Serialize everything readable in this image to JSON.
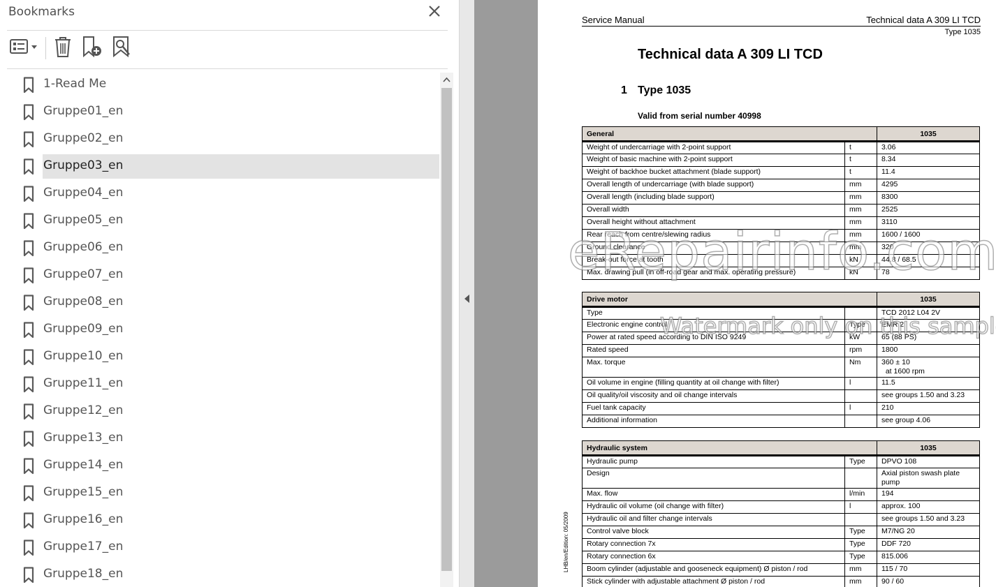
{
  "panel": {
    "title": "Bookmarks",
    "bookmarks": [
      {
        "label": "1-Read Me"
      },
      {
        "label": "Gruppe01_en"
      },
      {
        "label": "Gruppe02_en"
      },
      {
        "label": "Gruppe03_en",
        "selected": true
      },
      {
        "label": "Gruppe04_en"
      },
      {
        "label": "Gruppe05_en"
      },
      {
        "label": "Gruppe06_en"
      },
      {
        "label": "Gruppe07_en"
      },
      {
        "label": "Gruppe08_en"
      },
      {
        "label": "Gruppe09_en"
      },
      {
        "label": "Gruppe10_en"
      },
      {
        "label": "Gruppe11_en"
      },
      {
        "label": "Gruppe12_en"
      },
      {
        "label": "Gruppe13_en"
      },
      {
        "label": "Gruppe14_en"
      },
      {
        "label": "Gruppe15_en"
      },
      {
        "label": "Gruppe16_en"
      },
      {
        "label": "Gruppe17_en"
      },
      {
        "label": "Gruppe18_en"
      }
    ],
    "toolbar_icons": [
      "options-list-icon",
      "delete-bookmark-icon",
      "new-bookmark-icon",
      "find-bookmark-icon"
    ]
  },
  "document": {
    "header_left": "Service Manual",
    "header_right": "Technical data A 309 LI TCD",
    "header_type": "Type 1035",
    "title": "Technical data A 309 LI TCD",
    "section_number": "1",
    "section_title": "Type 1035",
    "valid_from": "Valid from serial number 40998",
    "side_note": "LHB/en/Edition: 05/2009",
    "watermark_main": "eRepairinfo.com",
    "watermark_sub": "Watermark only on this sample",
    "tables": [
      {
        "heading": "General",
        "value_heading": "1035",
        "rows": [
          [
            "Weight of undercarriage with 2-point support",
            "t",
            "3.06"
          ],
          [
            "Weight of basic machine with 2-point support",
            "t",
            "8.34"
          ],
          [
            "Weight of backhoe bucket attachment (blade support)",
            "t",
            "11.4"
          ],
          [
            "Overall length of undercarriage (with blade support)",
            "mm",
            "4295"
          ],
          [
            "Overall length (including blade support)",
            "mm",
            "8300"
          ],
          [
            "Overall width",
            "mm",
            "2525"
          ],
          [
            "Overall height without attachment",
            "mm",
            "3110"
          ],
          [
            "Rear reach from centre/slewing radius",
            "mm",
            "1600 / 1600"
          ],
          [
            "Ground clearance",
            "mm",
            "320"
          ],
          [
            "Break-out force at tooth",
            "kN",
            "44.8 / 68.5"
          ],
          [
            "Max. drawing pull (in off-road gear and max. operating pressure)",
            "kN",
            "78"
          ]
        ]
      },
      {
        "heading": "Drive motor",
        "value_heading": "1035",
        "rows": [
          [
            "Type",
            "",
            "TCD 2012 L04 2V"
          ],
          [
            "Electronic engine control",
            "Type",
            "EMR 2"
          ],
          [
            "Power at rated speed according to DIN ISO 9249",
            "kW",
            "65 (88 PS)"
          ],
          [
            "Rated speed",
            "rpm",
            "1800"
          ],
          [
            "Max. torque",
            "Nm",
            "360 ± 10\n  at 1600 rpm"
          ],
          [
            "Oil volume in engine (filling quantity at oil change with filter)",
            "l",
            "11.5"
          ],
          [
            "Oil quality/oil viscosity and oil change intervals",
            "",
            "see groups 1.50 and 3.23"
          ],
          [
            "Fuel tank capacity",
            "l",
            "210"
          ],
          [
            "Additional information",
            "",
            "see group 4.06"
          ]
        ]
      },
      {
        "heading": "Hydraulic system",
        "value_heading": "1035",
        "rows": [
          [
            "Hydraulic pump",
            "Type",
            "DPVO 108"
          ],
          [
            "Design",
            "",
            "Axial piston swash plate pump"
          ],
          [
            "Max. flow",
            "l/min",
            "194"
          ],
          [
            "Hydraulic oil volume (oil change with filter)",
            "l",
            "approx. 100"
          ],
          [
            "Hydraulic oil and filter change intervals",
            "",
            "see groups 1.50 and 3.23"
          ],
          [
            "Control valve block",
            "Type",
            "M7/NG 20"
          ],
          [
            "Rotary connection 7x",
            "Type",
            "DDF 720"
          ],
          [
            "Rotary connection 6x",
            "Type",
            "815.006"
          ],
          [
            "Boom cylinder (adjustable and gooseneck equipment) Ø piston / rod",
            "mm",
            "115 / 70"
          ],
          [
            "Stick cylinder with adjustable attachment Ø piston / rod",
            "mm",
            "90 / 60"
          ]
        ]
      }
    ]
  }
}
